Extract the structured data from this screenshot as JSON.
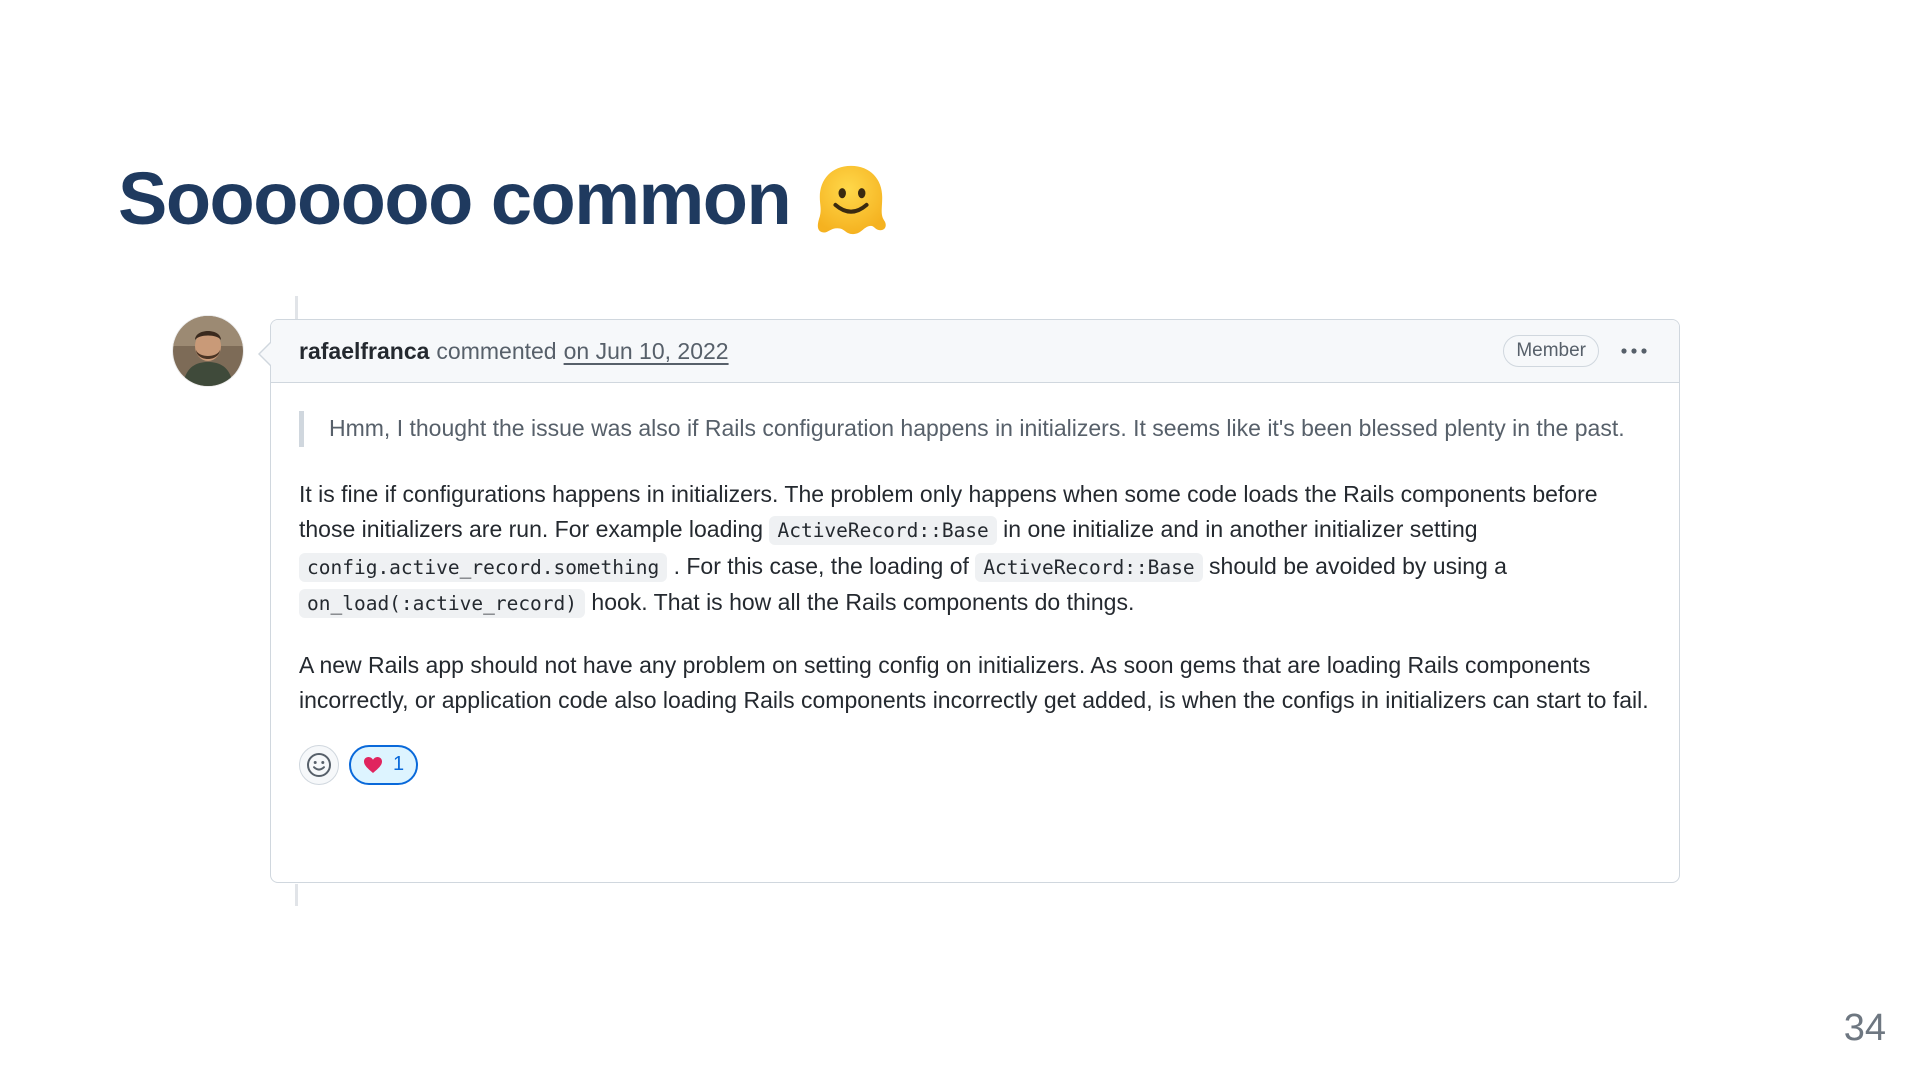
{
  "slide": {
    "title": "Sooooooo common",
    "title_emoji": "melting-face-icon",
    "page_number": "34"
  },
  "comment": {
    "author": "rafaelfranca",
    "action": "commented",
    "timestamp": "on Jun 10, 2022",
    "badge": "Member",
    "quote": "Hmm, I thought the issue was also if Rails configuration happens in initializers. It seems like it's been blessed plenty in the past.",
    "paragraph1": {
      "t1": "It is fine if configurations happens in initializers. The problem only happens when some code loads the Rails components before those initializers are run. For example loading ",
      "code1": "ActiveRecord::Base",
      "t2": " in one initialize and in another initializer setting ",
      "code2": "config.active_record.something",
      "t3": " . For this case, the loading of ",
      "code3": "ActiveRecord::Base",
      "t4": " should be avoided by using a ",
      "code4": "on_load(:active_record)",
      "t5": " hook. That is how all the Rails components do things."
    },
    "paragraph2": "A new Rails app should not have any problem on setting config on initializers. As soon gems that are loading Rails components incorrectly, or application code also loading Rails components incorrectly get added, is when the configs in initializers can start to fail.",
    "reactions": [
      {
        "icon": "heart-icon",
        "count": "1"
      }
    ]
  },
  "colors": {
    "title": "#1f3a5f",
    "border": "#d0d7de",
    "header_bg": "#f6f8fa",
    "reaction_accent": "#0969da"
  }
}
